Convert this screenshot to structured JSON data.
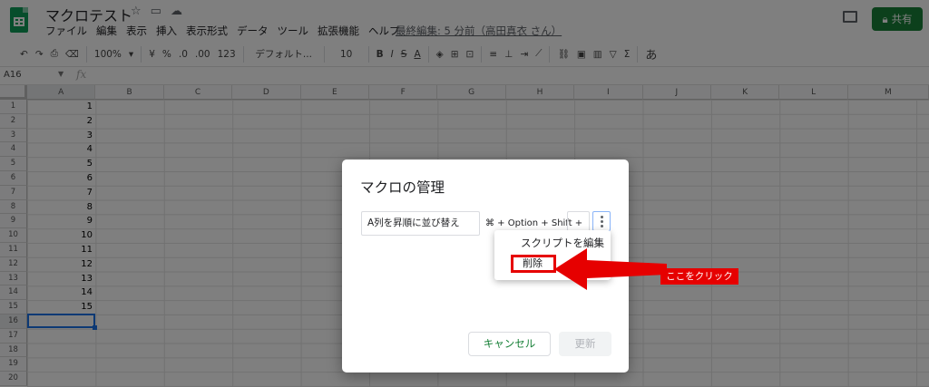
{
  "header": {
    "doc_title": "マクロテスト",
    "menu": [
      "ファイル",
      "編集",
      "表示",
      "挿入",
      "表示形式",
      "データ",
      "ツール",
      "拡張機能",
      "ヘルプ"
    ],
    "last_edit": "最終編集: 5 分前（高田真衣 さん）",
    "share_label": "共有",
    "share_color": "#188038"
  },
  "toolbar": {
    "zoom": "100%",
    "currency": "¥",
    "percent": "%",
    "decimal_decrease": ".0",
    "decimal_increase": ".00",
    "number_format": "123",
    "font": "デフォルト...",
    "font_size": "10",
    "bold": "B",
    "italic": "I",
    "strike": "S",
    "text_color": "A",
    "input_tools": "あ"
  },
  "formula_bar": {
    "cell_ref": "A16",
    "fx": "fx"
  },
  "grid": {
    "columns": [
      "A",
      "B",
      "C",
      "D",
      "E",
      "F",
      "G",
      "H",
      "I",
      "J",
      "K",
      "L",
      "M"
    ],
    "rows": [
      "1",
      "2",
      "3",
      "4",
      "5",
      "6",
      "7",
      "8",
      "9",
      "10",
      "11",
      "12",
      "13",
      "14",
      "15",
      "16",
      "17",
      "18",
      "19",
      "20"
    ],
    "column_a_values": [
      "1",
      "2",
      "3",
      "4",
      "5",
      "6",
      "7",
      "8",
      "9",
      "10",
      "11",
      "12",
      "13",
      "14",
      "15",
      "",
      "",
      "",
      "",
      ""
    ],
    "selected_cell": "A16"
  },
  "dialog": {
    "title": "マクロの管理",
    "macro_name": "A列を昇順に並び替え",
    "shortcut_prefix": "⌘ + Option + Shift +",
    "menu_edit_script": "スクリプトを編集",
    "menu_delete": "削除",
    "cancel_label": "キャンセル",
    "update_label": "更新",
    "accent_color": "#188038"
  },
  "annotation": {
    "callout_text": "ここをクリック",
    "color": "#e60000"
  }
}
